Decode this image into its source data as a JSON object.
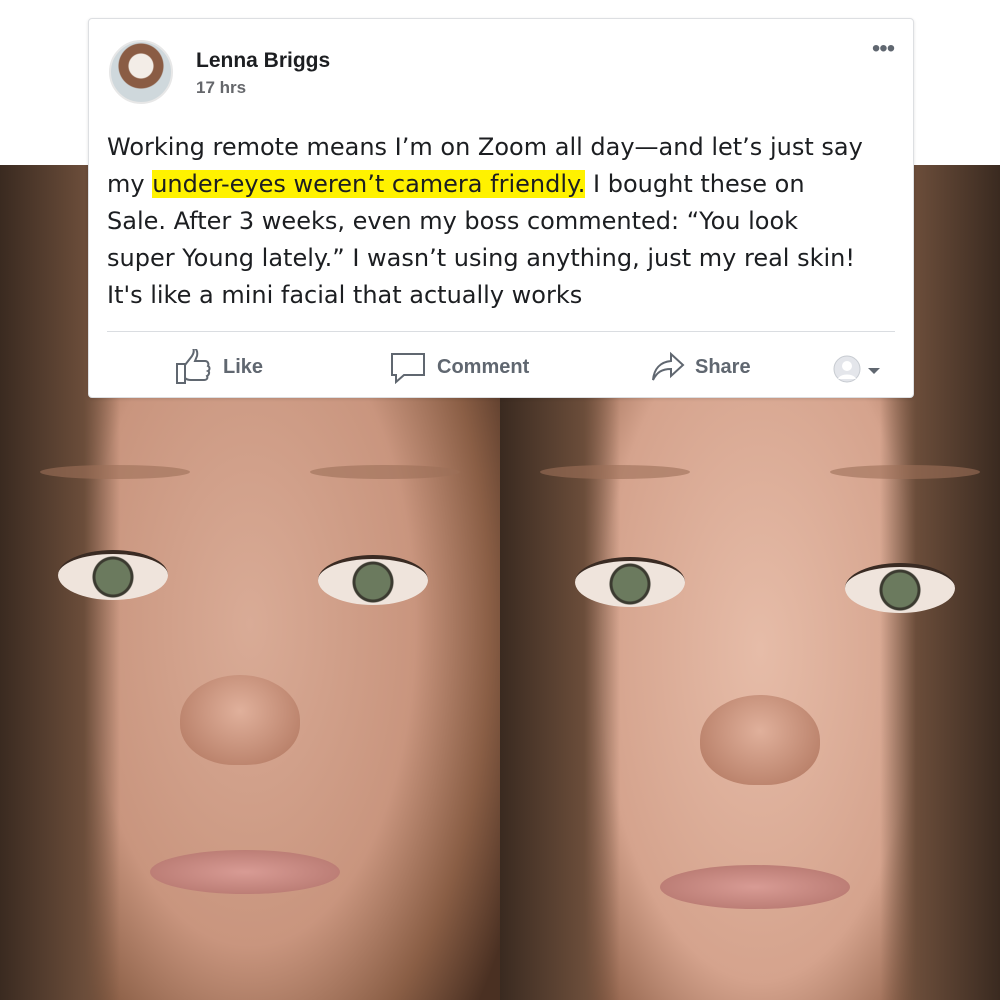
{
  "post": {
    "author": "Lenna Briggs",
    "time": "17 hrs",
    "more_label": "•••",
    "text_before": "Working remote means I’m on Zoom all day—and let’s just say my ",
    "text_highlight": "under-eyes weren’t camera friendly.",
    "text_after": " I bought these on Sale. After 3 weeks, even my boss commented: “You look super Young lately.” I wasn’t using anything, just my real skin! It's like a mini facial that actually works",
    "highlight_color": "#fff200"
  },
  "actions": {
    "like": "Like",
    "comment": "Comment",
    "share": "Share"
  },
  "icons": {
    "like": "thumbs-up-icon",
    "comment": "comment-bubble-icon",
    "share": "share-arrow-icon",
    "audience": "audience-avatar-icon",
    "dropdown": "caret-down-icon"
  }
}
